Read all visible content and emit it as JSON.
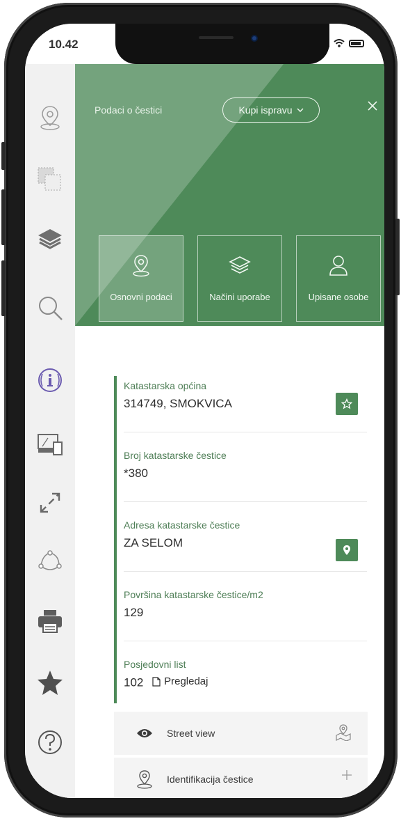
{
  "status_bar": {
    "time": "10.42"
  },
  "header": {
    "title": "Podaci o čestici",
    "buy_label": "Kupi ispravu"
  },
  "tabs": [
    {
      "label": "Osnovni podaci",
      "active": true,
      "icon": "map-pin-icon"
    },
    {
      "label": "Načini uporabe",
      "active": false,
      "icon": "layers-icon"
    },
    {
      "label": "Upisane osobe",
      "active": false,
      "icon": "person-icon"
    }
  ],
  "fields": {
    "opcina": {
      "label": "Katastarska općina",
      "value": "314749, SMOKVICA"
    },
    "broj": {
      "label": "Broj katastarske čestice",
      "value": "*380"
    },
    "adresa": {
      "label": "Adresa katastarske čestice",
      "value": "ZA SELOM"
    },
    "povrsina": {
      "label": "Površina katastarske čestice/m2",
      "value": "129"
    },
    "posjedovni": {
      "label": "Posjedovni list",
      "value": "102",
      "link": "Pregledaj"
    }
  },
  "actions": {
    "street_view": "Street view",
    "identifikacija": "Identifikacija čestice"
  },
  "colors": {
    "accent": "#4e8a59",
    "sidebar": "#f1f1f1",
    "info_icon": "#6b5bb0"
  }
}
